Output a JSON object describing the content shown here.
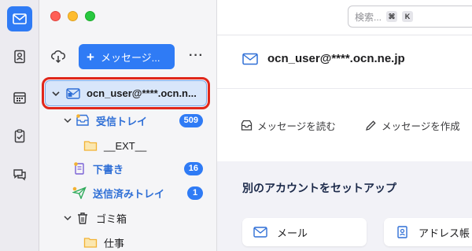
{
  "sidebar_rail": {
    "items": [
      {
        "icon": "mail-icon",
        "active": true
      },
      {
        "icon": "address-book-icon",
        "active": false
      },
      {
        "icon": "calendar-icon",
        "active": false
      },
      {
        "icon": "tasks-icon",
        "active": false
      },
      {
        "icon": "chat-icon",
        "active": false
      }
    ]
  },
  "toolbar": {
    "new_message_label": "メッセージ...",
    "more_label": "···"
  },
  "folders": {
    "account_label": "ocn_user@****.ocn.n...",
    "inbox_label": "受信トレイ",
    "inbox_count": "509",
    "ext_label": "__EXT__",
    "drafts_label": "下書き",
    "drafts_count": "16",
    "sent_label": "送信済みトレイ",
    "sent_count": "1",
    "trash_label": "ゴミ箱",
    "work_label": "仕事"
  },
  "search": {
    "placeholder": "検索...",
    "key1": "⌘",
    "key2": "K"
  },
  "main": {
    "account_title": "ocn_user@****.ocn.ne.jp",
    "read_messages": "メッセージを読む",
    "compose_message": "メッセージを作成",
    "setup_title": "別のアカウントをセットアップ",
    "mail_card": "メール",
    "address_card": "アドレス帳"
  },
  "colors": {
    "accent": "#2f7bf5",
    "highlight_outline": "#e0271b",
    "folder_yellow": "#f2b233"
  }
}
